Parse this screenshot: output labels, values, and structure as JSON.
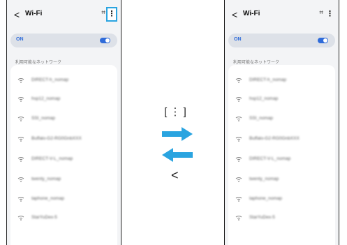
{
  "screen": {
    "title": "Wi-Fi",
    "back_glyph": "<",
    "scan_glyph": "⌗",
    "more_glyph": "⋮",
    "on_label": "ON",
    "section_label": "利用可能なネットワーク",
    "networks": [
      "DIRECT-h_nomap",
      "hsp12_nomap",
      "SSI_nomap",
      "Buffalo-G2-RG0GnbXXX",
      "DIRECT-V-L_nomap",
      "twenty_nomap",
      "taphone_nomap",
      "StarYuDex-5"
    ]
  },
  "middle": {
    "bracket_text": "[ ⋮ ]",
    "back_text": "<"
  },
  "colors": {
    "accent_blue": "#2aa4e0",
    "toggle_blue": "#2f6bd9",
    "screen_bg": "#f3f4f6"
  },
  "icons": [
    "back-chevron-icon",
    "qr-scan-icon",
    "more-options-icon",
    "wifi-icon",
    "arrow-right-icon",
    "arrow-left-icon"
  ]
}
